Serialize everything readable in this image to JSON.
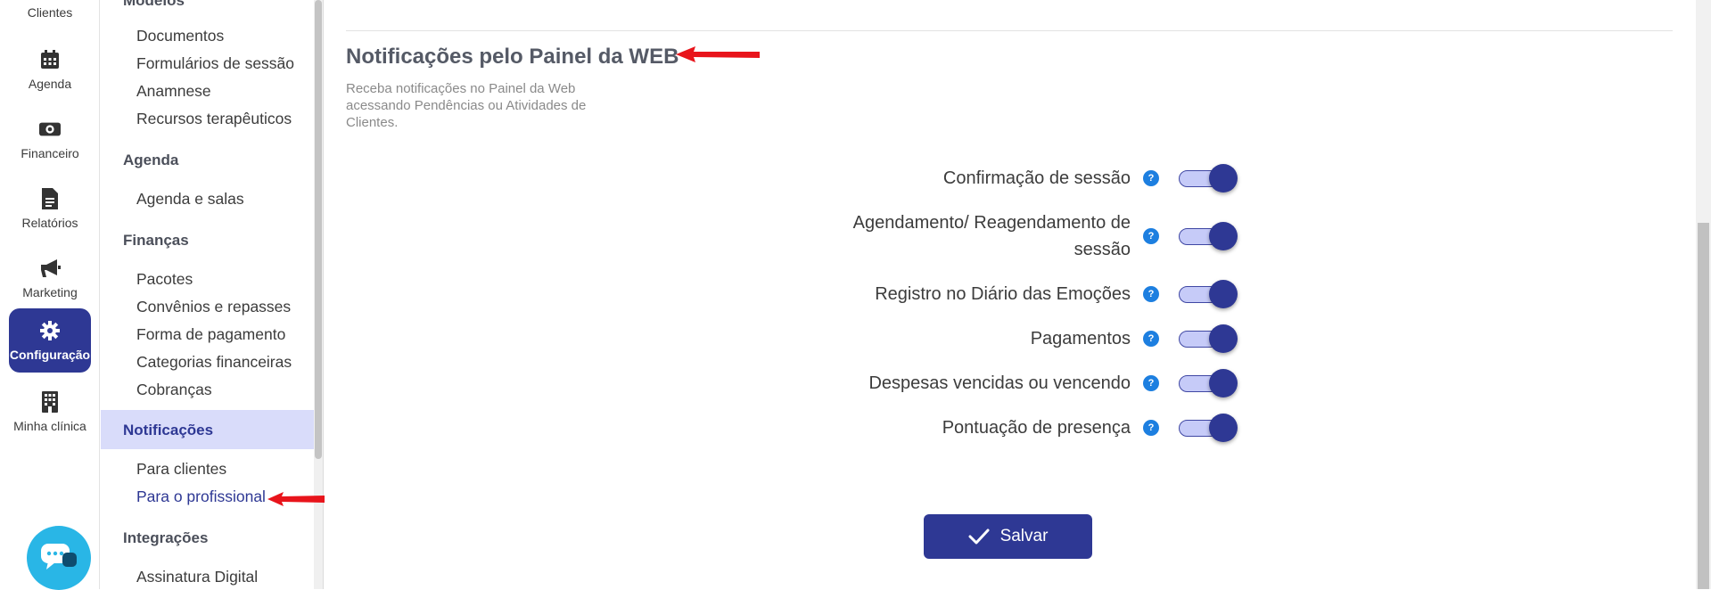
{
  "rail": {
    "items": [
      {
        "label": "Clientes",
        "icon": "users-icon"
      },
      {
        "label": "Agenda",
        "icon": "calendar-icon"
      },
      {
        "label": "Financeiro",
        "icon": "money-icon"
      },
      {
        "label": "Relatórios",
        "icon": "document-icon"
      },
      {
        "label": "Marketing",
        "icon": "megaphone-icon"
      },
      {
        "label": "Configuração",
        "icon": "gear-icon",
        "active": true
      },
      {
        "label": "Minha clínica",
        "icon": "building-icon"
      }
    ]
  },
  "menu": {
    "partial_group": "Modelos",
    "models_links": [
      "Documentos",
      "Formulários de sessão",
      "Anamnese",
      "Recursos terapêuticos"
    ],
    "agenda_group": "Agenda",
    "agenda_links": [
      "Agenda e salas"
    ],
    "finance_group": "Finanças",
    "finance_links": [
      "Pacotes",
      "Convênios e repasses",
      "Forma de pagamento",
      "Categorias financeiras",
      "Cobranças"
    ],
    "notifications_group": "Notificações",
    "notifications_links": [
      "Para clientes",
      "Para o profissional"
    ],
    "integrations_group": "Integrações",
    "integrations_links": [
      "Assinatura Digital"
    ]
  },
  "main": {
    "title": "Notificações pelo Painel da WEB",
    "description": "Receba notificações no Painel da Web acessando Pendências ou Atividades de Clientes.",
    "notifications": [
      {
        "label": "Confirmação de sessão",
        "enabled": true
      },
      {
        "label": "Agendamento/ Reagendamento de sessão",
        "enabled": true
      },
      {
        "label": "Registro no Diário das Emoções",
        "enabled": true
      },
      {
        "label": "Pagamentos",
        "enabled": true
      },
      {
        "label": "Despesas vencidas ou vencendo",
        "enabled": true
      },
      {
        "label": "Pontuação de presença",
        "enabled": true
      }
    ],
    "help_glyph": "?",
    "save_label": "Salvar"
  },
  "colors": {
    "primary": "#2e3894",
    "menu_active_bg": "#d9dcfa",
    "toggle_track": "#c6cbf8",
    "help_blue": "#1d7fe0",
    "chat_bubble": "#29b6e6",
    "annotation_red": "#e8141b"
  }
}
